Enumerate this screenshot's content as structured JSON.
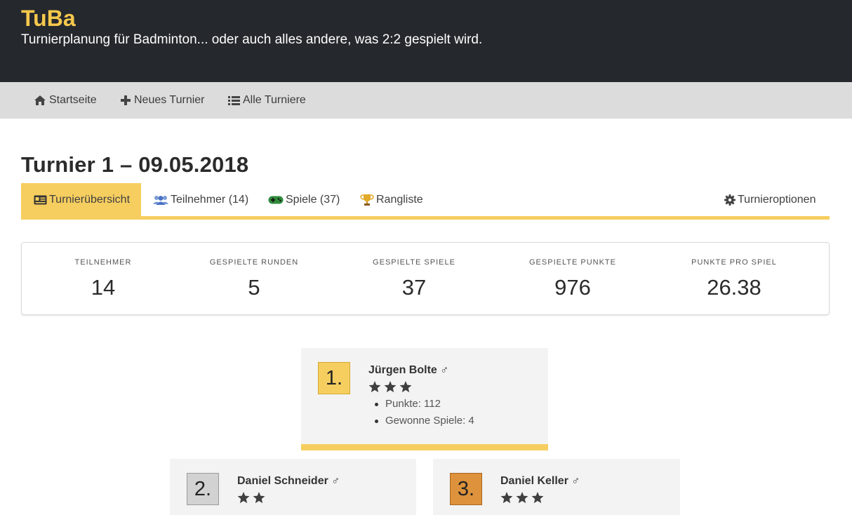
{
  "header": {
    "brand": "TuBa",
    "tagline": "Turnierplanung für Badminton... oder auch alles andere, was 2:2 gespielt wird."
  },
  "nav": [
    {
      "label": "Startseite",
      "icon": "home-icon"
    },
    {
      "label": "Neues Turnier",
      "icon": "plus-icon"
    },
    {
      "label": "Alle Turniere",
      "icon": "list-icon"
    }
  ],
  "page": {
    "title": "Turnier 1 – 09.05.2018"
  },
  "tabs": [
    {
      "label": "Turnierübersicht",
      "icon": "id-card-icon",
      "active": true
    },
    {
      "label": "Teilnehmer (14)",
      "icon": "users-icon",
      "active": false
    },
    {
      "label": "Spiele (37)",
      "icon": "gamepad-icon",
      "active": false
    },
    {
      "label": "Rangliste",
      "icon": "trophy-icon",
      "active": false
    },
    {
      "label": "Turnieroptionen",
      "icon": "gear-icon",
      "active": false
    }
  ],
  "stats": [
    {
      "label": "Teilnehmer",
      "value": "14"
    },
    {
      "label": "Gespielte Runden",
      "value": "5"
    },
    {
      "label": "Gespielte Spiele",
      "value": "37"
    },
    {
      "label": "Gespielte Punkte",
      "value": "976"
    },
    {
      "label": "Punkte pro Spiel",
      "value": "26.38"
    }
  ],
  "podium": [
    {
      "rank": "1.",
      "name": "Jürgen Bolte ♂",
      "stars": 3,
      "points": "Punkte: 112",
      "wins": "Gewonne Spiele: 4"
    },
    {
      "rank": "2.",
      "name": "Daniel Schneider ♂",
      "stars": 2
    },
    {
      "rank": "3.",
      "name": "Daniel Keller ♂",
      "stars": 3
    }
  ],
  "colors": {
    "header_bg": "#25282d",
    "brand": "#f6c84c",
    "accent": "#f6ce5f",
    "nav_bg": "#dcdcdc",
    "card_bg": "#f3f3f3",
    "gold": "#f6ce5f",
    "silver": "#d2d2d2",
    "bronze": "#dd923b"
  }
}
